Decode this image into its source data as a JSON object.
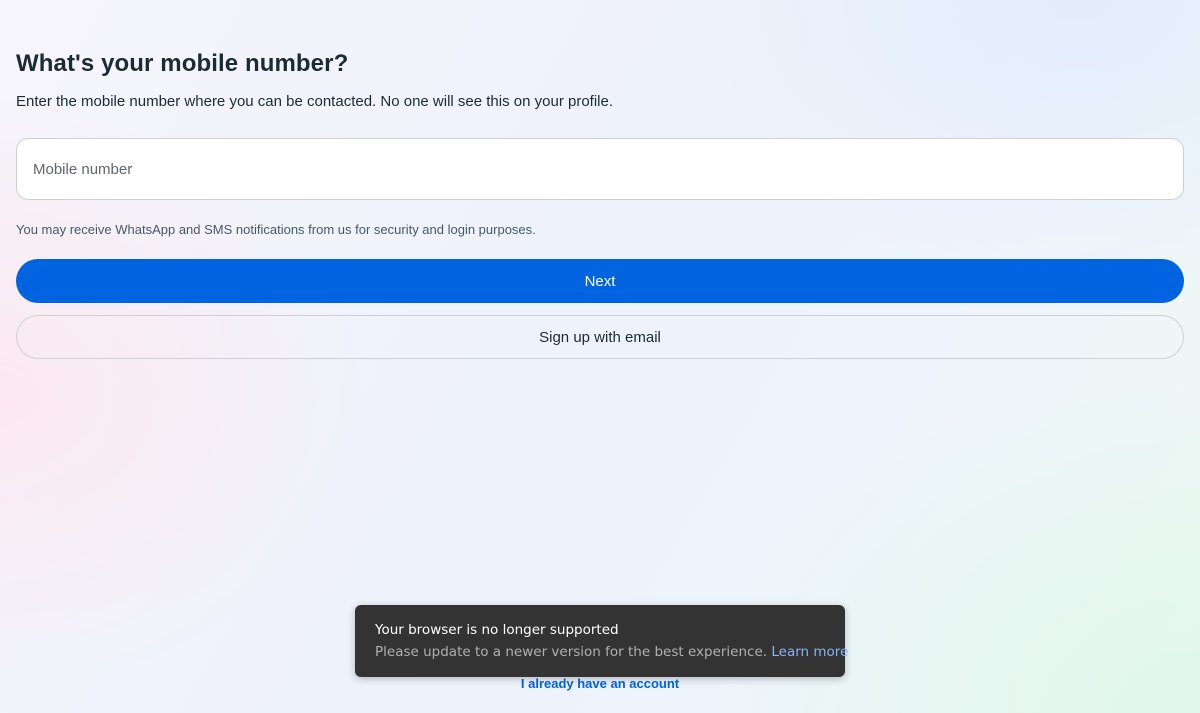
{
  "page": {
    "title": "What's your mobile number?",
    "subtitle": "Enter the mobile number where you can be contacted. No one will see this on your profile."
  },
  "form": {
    "mobile_placeholder": "Mobile number",
    "mobile_value": "",
    "notice": "You may receive WhatsApp and SMS notifications from us for security and login purposes.",
    "next_label": "Next",
    "email_signup_label": "Sign up with email"
  },
  "footer": {
    "already_account_label": "I already have an account"
  },
  "browser_toast": {
    "title": "Your browser is no longer supported",
    "message": "Please update to a newer version for the best experience.",
    "link_label": "Learn more"
  },
  "colors": {
    "primary": "#0064e0",
    "text": "#1c2b33",
    "toast_background": "#333333",
    "toast_link": "#8ab4f8"
  }
}
